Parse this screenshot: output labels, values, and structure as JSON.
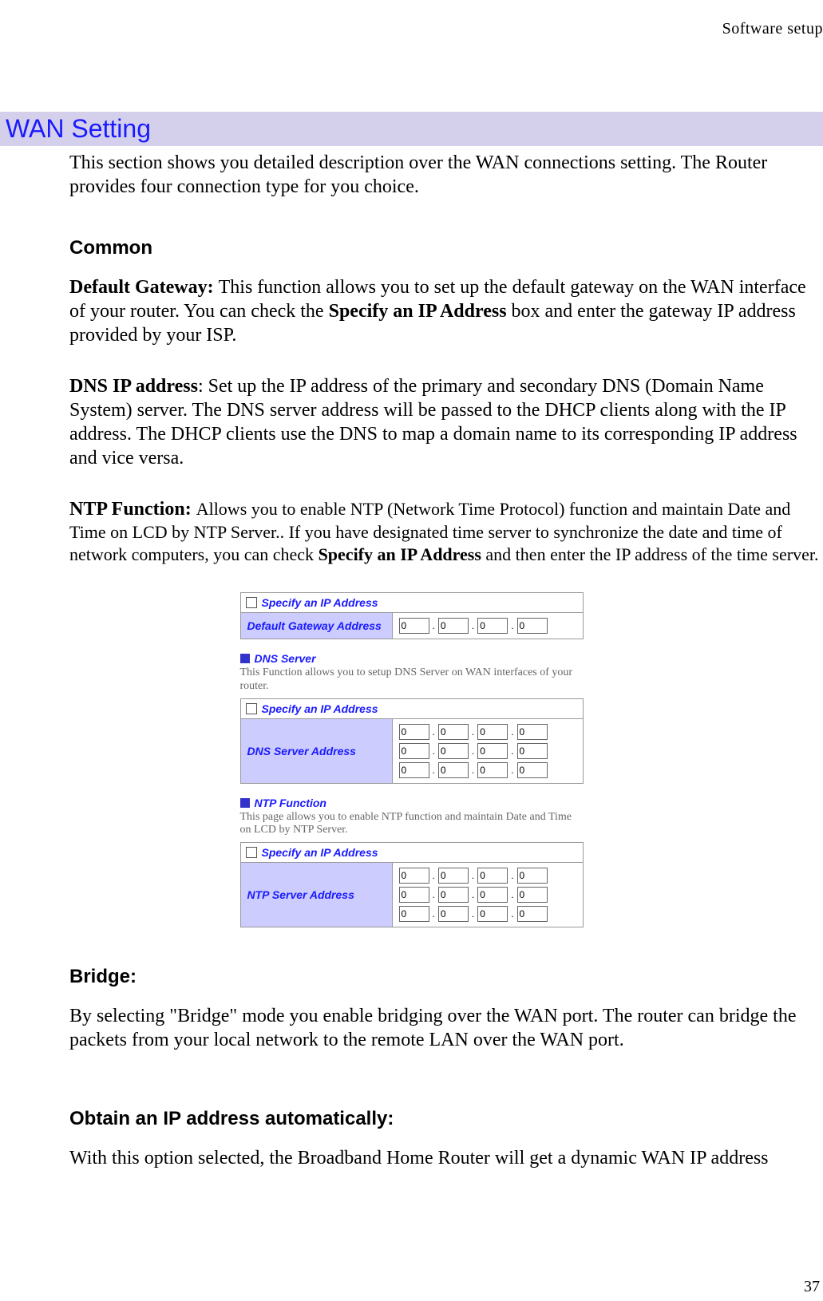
{
  "header": "Software  setup",
  "pageNumber": "37",
  "title": "WAN Setting",
  "intro": "This section shows you detailed description over the WAN connections setting. The Router provides four connection type for you choice.",
  "common": {
    "heading": "Common",
    "gateway_pre": "Default Gateway: ",
    "gateway_mid1": "This function allows you to set up the default gateway on the WAN interface of your router. You can check the ",
    "gateway_bold": "Specify an IP Address",
    "gateway_mid2": " box and enter the gateway IP address provided by your ISP.",
    "dns_pre": "DNS IP address",
    "dns_body": ": Set up the IP address of the primary and secondary DNS (Domain Name System) server. The DNS server address will be passed to the DHCP clients along with the IP address. The DHCP clients use the DNS to map a domain name to its corresponding IP address and vice versa.",
    "ntp_pre": "NTP Function: ",
    "ntp_mid1": "Allows you to enable NTP (Network Time Protocol) function and maintain Date and Time on LCD by NTP Server.. If you have designated time server to synchronize the date and time of network computers, you can check ",
    "ntp_bold": "Specify an IP Address",
    "ntp_mid2": " and then enter the IP address of the time server."
  },
  "screenshot": {
    "specify_label": "Specify an IP Address",
    "gateway_label": "Default Gateway Address",
    "dns_section": "DNS Server",
    "dns_desc": "This Function allows you to setup DNS Server on WAN interfaces of your router.",
    "dns_label": "DNS Server Address",
    "ntp_section": "NTP Function",
    "ntp_desc": "This page allows you to enable NTP function and maintain Date and Time on LCD by NTP Server.",
    "ntp_label": "NTP Server Address",
    "ip_val": "0"
  },
  "bridge": {
    "heading": "Bridge:",
    "body": "By selecting \"Bridge\" mode you enable bridging over the WAN port. The router can bridge the packets from your local network to the remote LAN over the WAN port."
  },
  "obtain": {
    "heading": "Obtain an IP address automatically:",
    "body": "With this option selected, the Broadband Home Router will get a dynamic WAN IP address"
  }
}
